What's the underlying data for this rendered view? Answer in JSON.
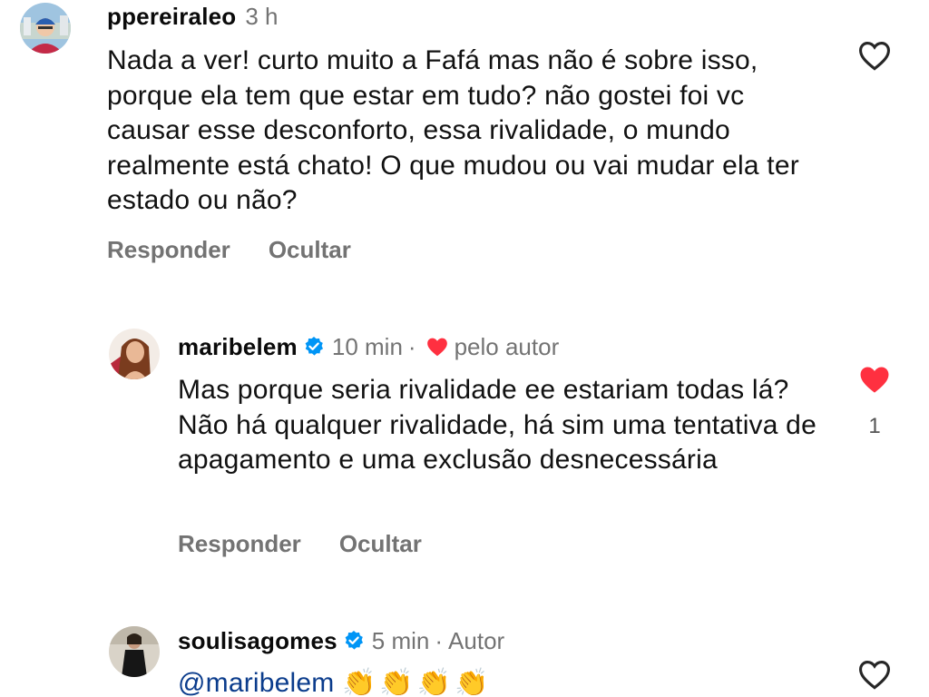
{
  "comments": [
    {
      "username": "ppereiraleo",
      "time": "3 h",
      "text": "Nada a ver! curto muito a Fafá mas não é sobre isso, porque ela tem que estar em tudo? não gostei foi vc causar esse desconforto, essa rivalidade, o mundo realmente está chato!  O que mudou ou vai mudar ela ter estado ou não?",
      "reply_label": "Responder",
      "hide_label": "Ocultar",
      "liked": false
    },
    {
      "username": "maribelem",
      "verified": true,
      "time": "10 min",
      "separator": "·",
      "author_like_label": "pelo autor",
      "text": "Mas porque seria rivalidade ee estariam todas lá? Não há qualquer rivalidade, há sim uma tentativa de apagamento e uma exclusão desnecessária",
      "reply_label": "Responder",
      "hide_label": "Ocultar",
      "liked": true,
      "like_count": "1"
    },
    {
      "username": "soulisagomes",
      "verified": true,
      "time": "5 min",
      "separator": "·",
      "author_label": "Autor",
      "mention": "@maribelem",
      "emojis": "👏👏👏👏",
      "liked": false
    }
  ],
  "colors": {
    "verified": "#0095f6",
    "like_red": "#ff3040",
    "meta_gray": "#737373",
    "mention_blue": "#0b3c8c"
  }
}
